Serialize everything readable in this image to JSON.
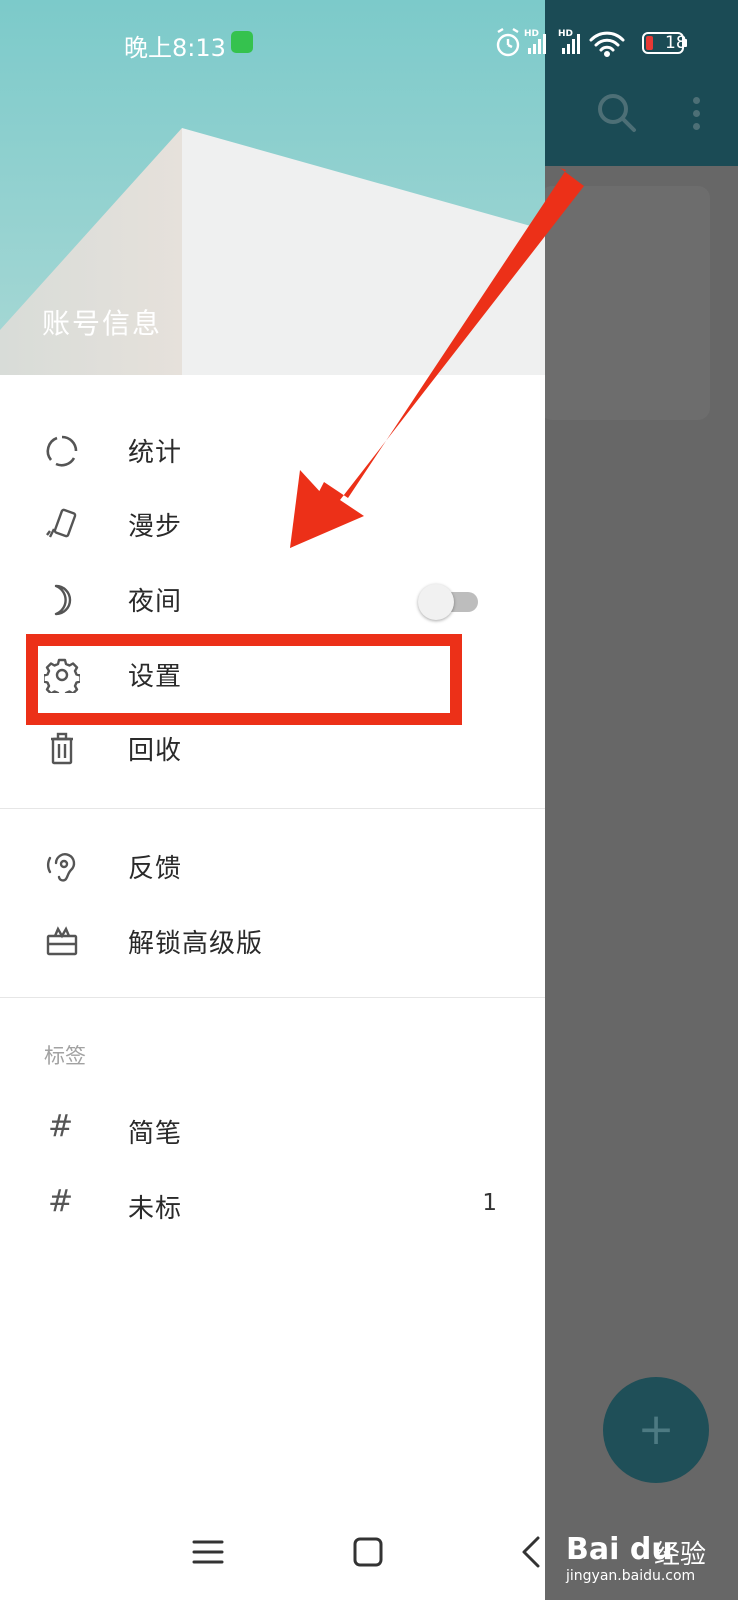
{
  "status_bar": {
    "time": "晚上8:13",
    "battery": "18",
    "network_labels": [
      "HD",
      "HD"
    ]
  },
  "drawer": {
    "header_title": "账号信息",
    "primary_items": [
      {
        "label": "统计",
        "icon": "stats-icon"
      },
      {
        "label": "漫步",
        "icon": "wander-icon"
      },
      {
        "label": "夜间",
        "icon": "moon-icon",
        "toggle": false
      },
      {
        "label": "设置",
        "icon": "gear-icon"
      },
      {
        "label": "回收",
        "icon": "trash-icon"
      }
    ],
    "secondary_items": [
      {
        "label": "反馈",
        "icon": "ear-icon"
      },
      {
        "label": "解锁高级版",
        "icon": "gift-icon"
      }
    ],
    "tags_section_label": "标签",
    "tags": [
      {
        "label": "简笔",
        "icon": "hash-icon",
        "symbol": "#"
      },
      {
        "label": "未标",
        "icon": "hash-icon",
        "symbol": "#",
        "count": "1"
      }
    ]
  },
  "background_app": {
    "fab_symbol": "+"
  },
  "watermark": {
    "brand": "Bai du",
    "suffix": "经验",
    "url": "jingyan.baidu.com"
  },
  "colors": {
    "header": "#86cdcd",
    "toolbar": "#1b4b55",
    "highlight": "#ec3018",
    "scrim": "#676767"
  }
}
